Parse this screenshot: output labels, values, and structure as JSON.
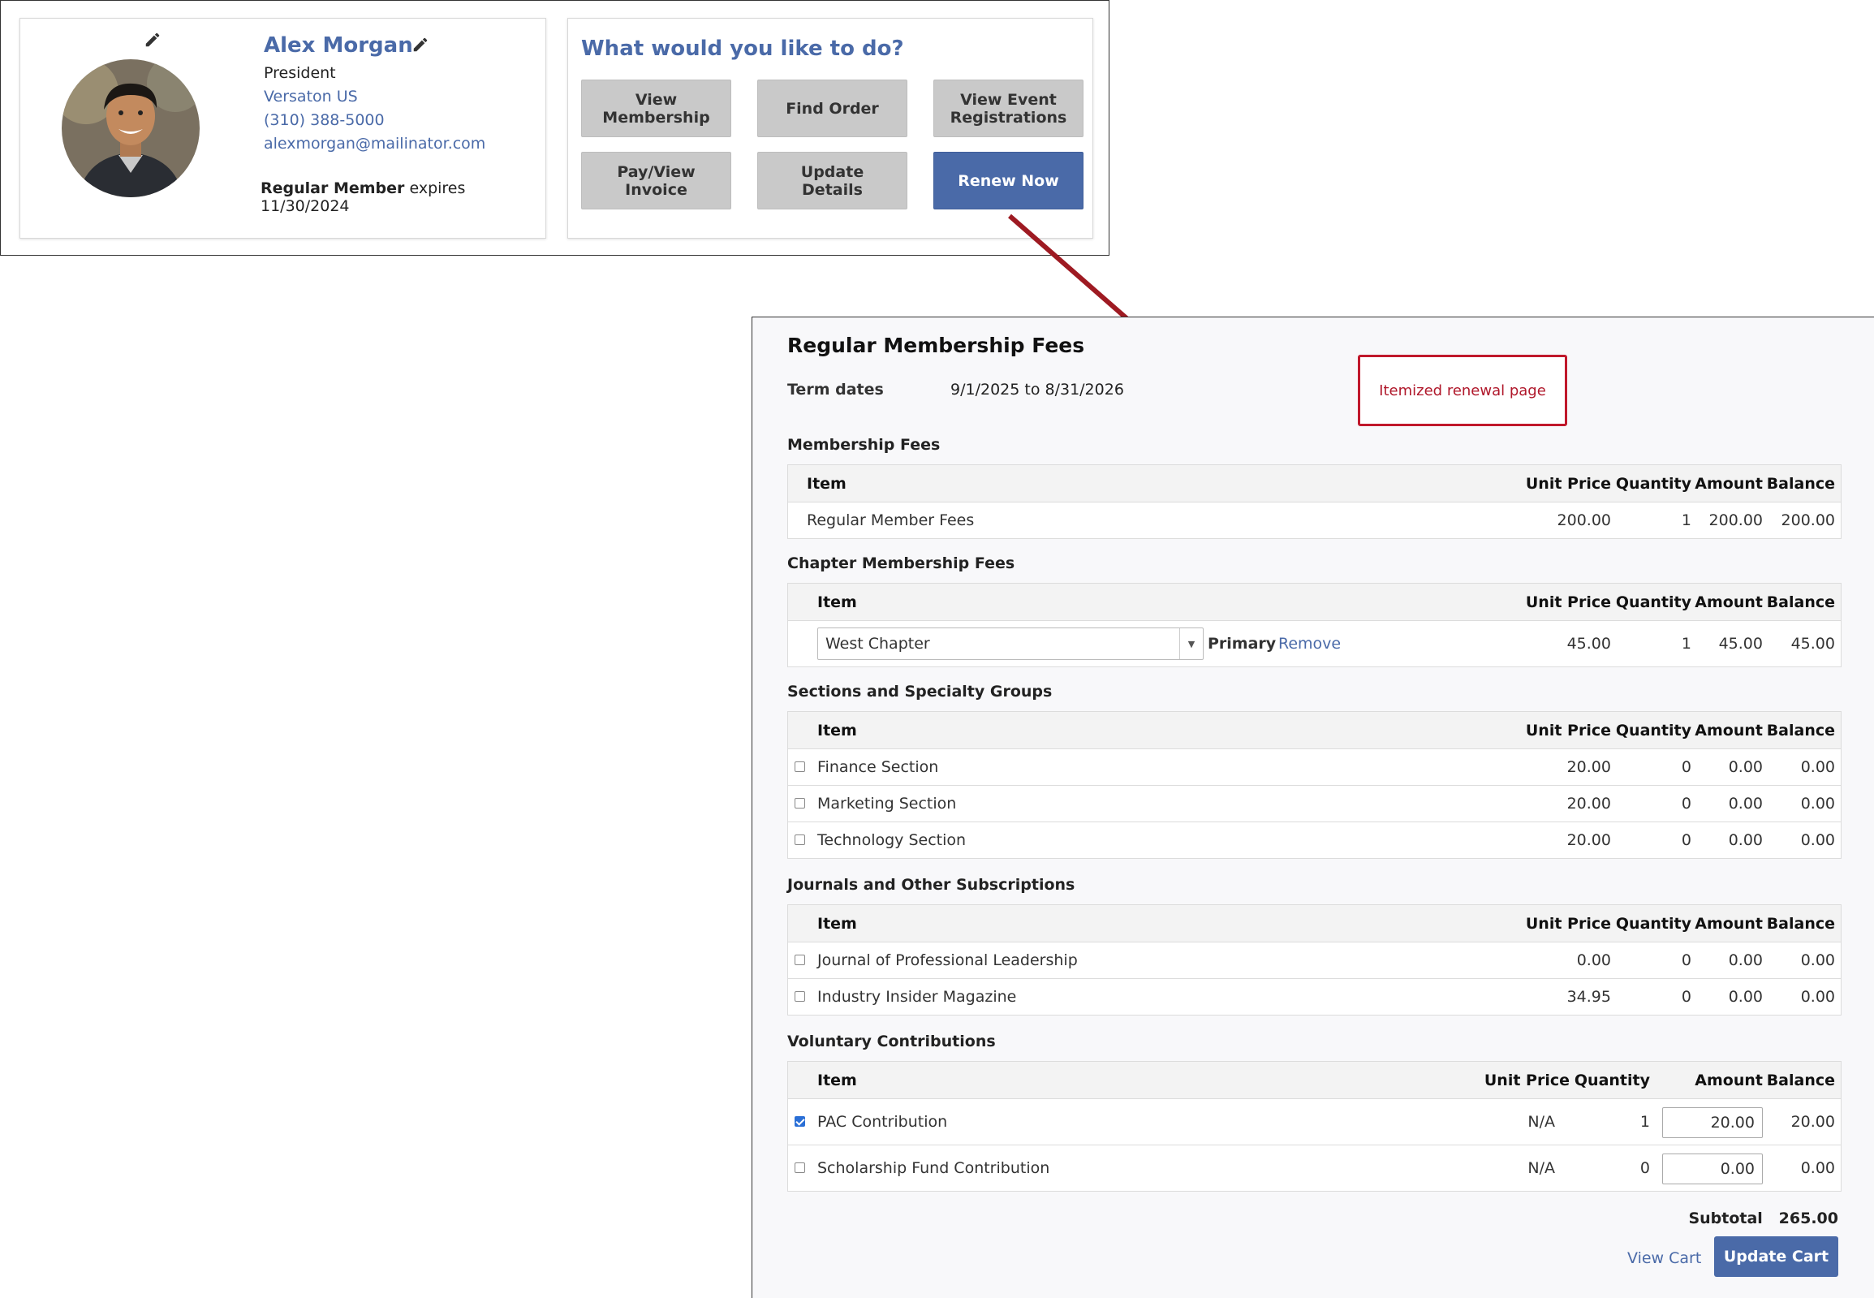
{
  "profile": {
    "name": "Alex Morgan",
    "title": "President",
    "company": "Versaton US",
    "phone": "(310) 388-5000",
    "email": "alexmorgan@mailinator.com",
    "member_type": "Regular Member",
    "expires_text": "expires 11/30/2024"
  },
  "actions": {
    "heading": "What would you like to do?",
    "buttons": [
      {
        "label": "View\nMembership"
      },
      {
        "label": "Find Order"
      },
      {
        "label": "View Event\nRegistrations"
      },
      {
        "label": "Pay/View\nInvoice"
      },
      {
        "label": "Update\nDetails"
      },
      {
        "label": "Renew Now"
      }
    ]
  },
  "callout": {
    "text": "Itemized renewal page"
  },
  "renewal": {
    "title": "Regular Membership Fees",
    "term_label": "Term dates",
    "term_value": "9/1/2025 to 8/31/2026",
    "columns": {
      "item": "Item",
      "unit_price": "Unit Price",
      "quantity": "Quantity",
      "amount": "Amount",
      "balance": "Balance"
    },
    "sections": [
      {
        "heading": "Membership Fees",
        "rows": [
          {
            "item": "Regular Member Fees",
            "unit_price": "200.00",
            "quantity": "1",
            "amount": "200.00",
            "balance": "200.00"
          }
        ]
      },
      {
        "heading": "Chapter Membership Fees",
        "rows": [
          {
            "select_value": "West Chapter",
            "primary": "Primary",
            "remove": "Remove",
            "unit_price": "45.00",
            "quantity": "1",
            "amount": "45.00",
            "balance": "45.00"
          }
        ]
      },
      {
        "heading": "Sections and Specialty Groups",
        "rows": [
          {
            "item": "Finance Section",
            "checked": false,
            "unit_price": "20.00",
            "quantity": "0",
            "amount": "0.00",
            "balance": "0.00"
          },
          {
            "item": "Marketing Section",
            "checked": false,
            "unit_price": "20.00",
            "quantity": "0",
            "amount": "0.00",
            "balance": "0.00"
          },
          {
            "item": "Technology Section",
            "checked": false,
            "unit_price": "20.00",
            "quantity": "0",
            "amount": "0.00",
            "balance": "0.00"
          }
        ]
      },
      {
        "heading": "Journals and Other Subscriptions",
        "rows": [
          {
            "item": "Journal of Professional Leadership",
            "checked": false,
            "unit_price": "0.00",
            "quantity": "0",
            "amount": "0.00",
            "balance": "0.00"
          },
          {
            "item": "Industry Insider Magazine",
            "checked": false,
            "unit_price": "34.95",
            "quantity": "0",
            "amount": "0.00",
            "balance": "0.00"
          }
        ]
      },
      {
        "heading": "Voluntary Contributions",
        "rows": [
          {
            "item": "PAC Contribution",
            "checked": true,
            "unit_price": "N/A",
            "quantity": "1",
            "amount": "20.00",
            "balance": "20.00"
          },
          {
            "item": "Scholarship Fund Contribution",
            "checked": false,
            "unit_price": "N/A",
            "quantity": "0",
            "amount": "0.00",
            "balance": "0.00"
          }
        ]
      }
    ],
    "subtotal_label": "Subtotal",
    "subtotal_value": "265.00",
    "view_cart": "View Cart",
    "update_cart": "Update Cart"
  },
  "colors": {
    "brand_blue": "#4a6aa8",
    "callout_red": "#c0182b",
    "arrow_red": "#9e1a22"
  }
}
